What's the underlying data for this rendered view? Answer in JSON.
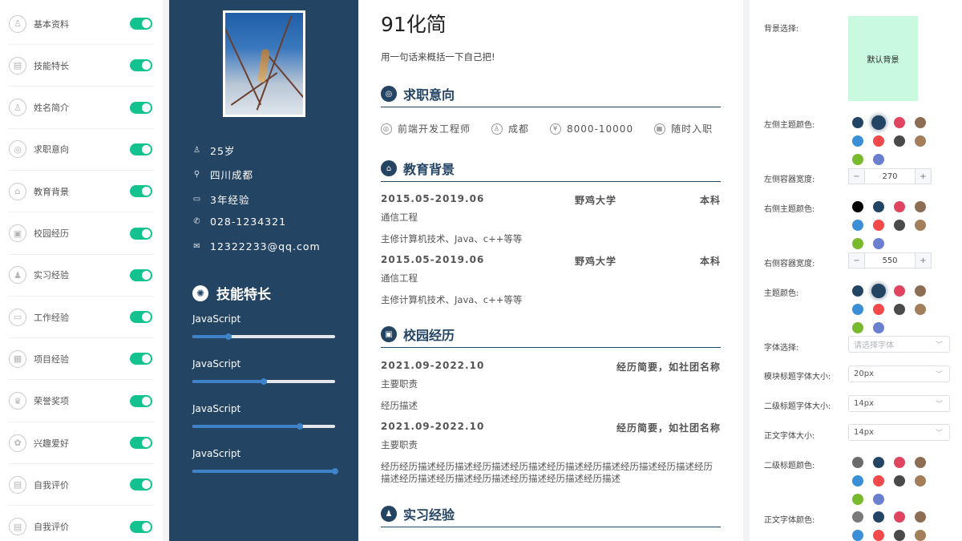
{
  "modules": [
    {
      "label": "基本资料",
      "icon": "user-icon",
      "glyph": "♙"
    },
    {
      "label": "技能特长",
      "icon": "book-icon",
      "glyph": "▤"
    },
    {
      "label": "姓名简介",
      "icon": "person-icon",
      "glyph": "♙"
    },
    {
      "label": "求职意向",
      "icon": "target-icon",
      "glyph": "◎"
    },
    {
      "label": "教育背景",
      "icon": "graduation-cap-icon",
      "glyph": "⌂"
    },
    {
      "label": "校园经历",
      "icon": "certificate-icon",
      "glyph": "▣"
    },
    {
      "label": "实习经验",
      "icon": "intern-icon",
      "glyph": "♟"
    },
    {
      "label": "工作经验",
      "icon": "briefcase-icon",
      "glyph": "▭"
    },
    {
      "label": "项目经验",
      "icon": "project-icon",
      "glyph": "▦"
    },
    {
      "label": "荣誉奖项",
      "icon": "trophy-icon",
      "glyph": "♛"
    },
    {
      "label": "兴趣爱好",
      "icon": "hobby-icon",
      "glyph": "✿"
    },
    {
      "label": "自我评价",
      "icon": "comment-icon",
      "glyph": "▤"
    },
    {
      "label": "自我评价",
      "icon": "comment-icon",
      "glyph": "▤"
    }
  ],
  "profile": {
    "age": "25岁",
    "location": "四川成都",
    "experience": "3年经验",
    "phone": "028-1234321",
    "email": "12322233@qq.com"
  },
  "skills_title": "技能特长",
  "skills": [
    {
      "name": "JavaScript",
      "level": 0.25
    },
    {
      "name": "JavaScript",
      "level": 0.5
    },
    {
      "name": "JavaScript",
      "level": 0.75
    },
    {
      "name": "JavaScript",
      "level": 1.0
    }
  ],
  "resume": {
    "name": "91化简",
    "tagline": "用一句话来概括一下自己把!",
    "intent_title": "求职意向",
    "intent": {
      "position": "前端开发工程师",
      "city": "成都",
      "salary": "8000-10000",
      "availability": "随时入职"
    },
    "education_title": "教育背景",
    "education": [
      {
        "period": "2015.05-2019.06",
        "school": "野鸡大学",
        "degree": "本科",
        "major": "通信工程",
        "desc": "主修计算机技术、Java、c++等等"
      },
      {
        "period": "2015.05-2019.06",
        "school": "野鸡大学",
        "degree": "本科",
        "major": "通信工程",
        "desc": "主修计算机技术、Java、c++等等"
      }
    ],
    "campus_title": "校园经历",
    "campus": [
      {
        "period": "2021.09-2022.10",
        "org": "经历简要，如社团名称",
        "role": "主要职责",
        "desc": "经历描述"
      },
      {
        "period": "2021.09-2022.10",
        "org": "经历简要，如社团名称",
        "role": "主要职责",
        "desc": "经历经历描述经历描述经历描述经历描述经历描述经历描述经历描述经历描述经历描述经历描述经历描述经历描述经历描述经历描述经历描述"
      }
    ],
    "intern_title": "实习经验"
  },
  "settings": {
    "bg_label": "背景选择:",
    "bg_default": "默认背景",
    "left_theme_label": "左侧主题颜色:",
    "left_width_label": "左侧容器宽度:",
    "left_width": "270",
    "right_theme_label": "右侧主题颜色:",
    "right_width_label": "右侧容器宽度:",
    "right_width": "550",
    "theme_label": "主题颜色:",
    "font_label": "字体选择:",
    "font_placeholder": "请选择字体",
    "module_title_size_label": "模块标题字体大小:",
    "module_title_size": "20px",
    "sub_title_size_label": "二级标题字体大小:",
    "sub_title_size": "14px",
    "body_size_label": "正文字体大小:",
    "body_size": "14px",
    "sub_title_color_label": "二级标题颜色:",
    "body_color_label": "正文字体颜色:",
    "minus": "−",
    "plus": "+",
    "palette_left": [
      "#244463",
      "#244463",
      "#e0445e",
      "#8d6e55",
      "#3a8fd6",
      "#f24a4a",
      "#4a4a4a",
      "#a37e5a",
      "#79b92e",
      "#6b7fcf"
    ],
    "palette_right": [
      "#000000",
      "#244463",
      "#e0445e",
      "#8d6e55",
      "#3a8fd6",
      "#f24a4a",
      "#4a4a4a",
      "#a37e5a",
      "#79b92e",
      "#6b7fcf"
    ],
    "palette_theme": [
      "#244463",
      "#244463",
      "#e0445e",
      "#8d6e55",
      "#3a8fd6",
      "#f24a4a",
      "#4a4a4a",
      "#a37e5a",
      "#79b92e",
      "#6b7fcf"
    ],
    "palette_sub": [
      "#6b6b6b",
      "#244463",
      "#e0445e",
      "#8d6e55",
      "#3a8fd6",
      "#f24a4a",
      "#4a4a4a",
      "#a37e5a",
      "#79b92e",
      "#6b7fcf"
    ],
    "palette_body": [
      "#7a7a7a",
      "#244463",
      "#e0445e",
      "#8d6e55",
      "#3a8fd6",
      "#f24a4a",
      "#4a4a4a",
      "#a37e5a"
    ]
  }
}
